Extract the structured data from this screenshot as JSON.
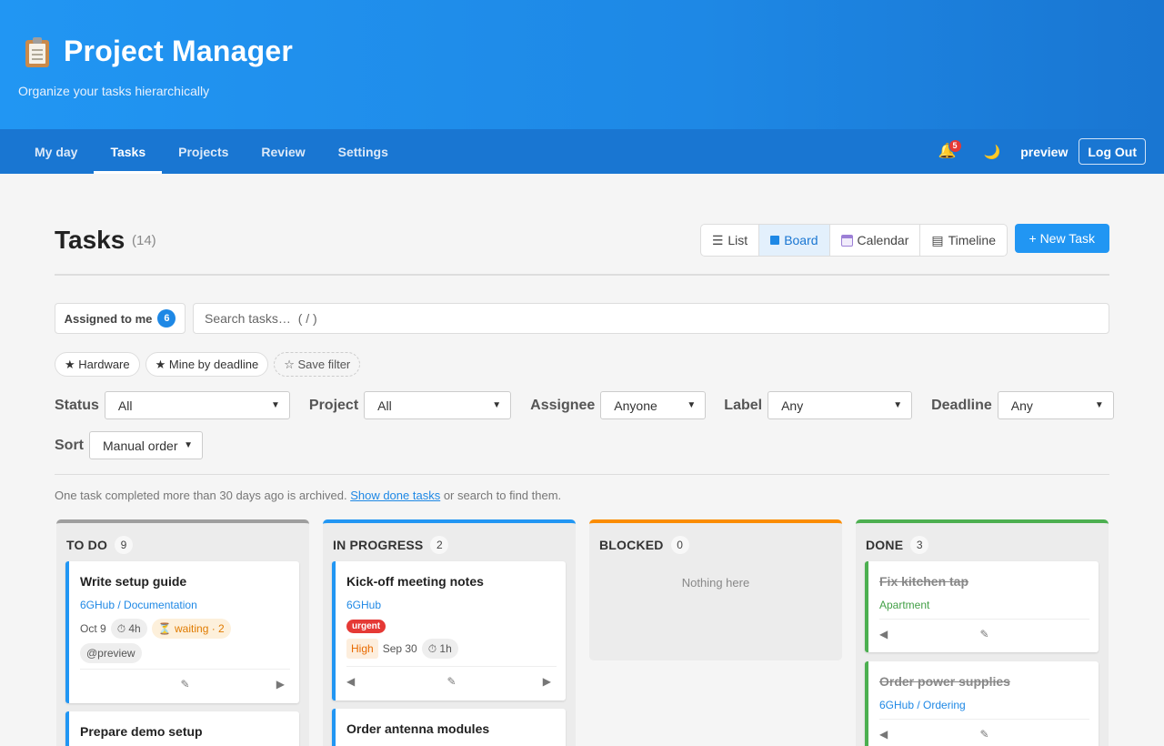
{
  "app": {
    "title": "Project Manager",
    "subtitle": "Organize your tasks hierarchically"
  },
  "nav": {
    "tabs": [
      {
        "label": "My day"
      },
      {
        "label": "Tasks",
        "active": true
      },
      {
        "label": "Projects"
      },
      {
        "label": "Review"
      },
      {
        "label": "Settings"
      }
    ],
    "notifications": "5",
    "user": "preview",
    "logout_label": "Log Out"
  },
  "page": {
    "title": "Tasks",
    "count": "(14)",
    "views": [
      {
        "icon": "list-icon",
        "glyph": "☰",
        "label": "List"
      },
      {
        "icon": "board-icon",
        "label": "Board",
        "active": true
      },
      {
        "icon": "calendar-icon",
        "label": "Calendar"
      },
      {
        "icon": "timeline-icon",
        "glyph": "▤",
        "label": "Timeline"
      }
    ],
    "new_task_label": "+ New Task"
  },
  "search": {
    "assigned_label": "Assigned to me",
    "assigned_count": "6",
    "placeholder": "Search tasks…  ( / )"
  },
  "saved_filters": [
    {
      "label": "★ Hardware"
    },
    {
      "label": "★ Mine by deadline"
    },
    {
      "label": "☆ Save filter",
      "dashed": true
    }
  ],
  "filters": {
    "status_label": "Status",
    "status_value": "All",
    "project_label": "Project",
    "project_value": "All",
    "assignee_label": "Assignee",
    "assignee_value": "Anyone",
    "label_label": "Label",
    "label_value": "Any",
    "deadline_label": "Deadline",
    "deadline_value": "Any",
    "sort_label": "Sort",
    "sort_value": "Manual order"
  },
  "archive": {
    "before": "One task completed more than 30 days ago is archived. ",
    "link": "Show done tasks",
    "after": " or search to find them."
  },
  "board": {
    "columns": [
      {
        "title": "TO DO",
        "count": "9",
        "color": "#9e9e9e",
        "cards": [
          {
            "title": "Write setup guide",
            "project": "6GHub / Documentation",
            "date": "Oct 9",
            "estimate": "⏱ 4h",
            "waiting": "⏳ waiting · 2",
            "assignee": "@preview"
          },
          {
            "title": "Prepare demo setup"
          }
        ]
      },
      {
        "title": "IN PROGRESS",
        "count": "2",
        "color": "#2196f3",
        "cards": [
          {
            "title": "Kick-off meeting notes",
            "project": "6GHub",
            "tag": "urgent",
            "priority": "High",
            "date": "Sep 30",
            "estimate": "⏱ 1h"
          },
          {
            "title": "Order antenna modules"
          }
        ]
      },
      {
        "title": "BLOCKED",
        "count": "0",
        "color": "#fb8c00",
        "empty": "Nothing here"
      },
      {
        "title": "DONE",
        "count": "3",
        "color": "#4caf50",
        "cards": [
          {
            "title": "Fix kitchen tap",
            "project": "Apartment"
          },
          {
            "title": "Order power supplies",
            "project": "6GHub / Ordering"
          }
        ]
      }
    ]
  },
  "colors": {
    "accent": "#2196f3",
    "header": "#1976d2",
    "urgent": "#e53935",
    "done": "#4caf50",
    "blocked": "#fb8c00"
  }
}
